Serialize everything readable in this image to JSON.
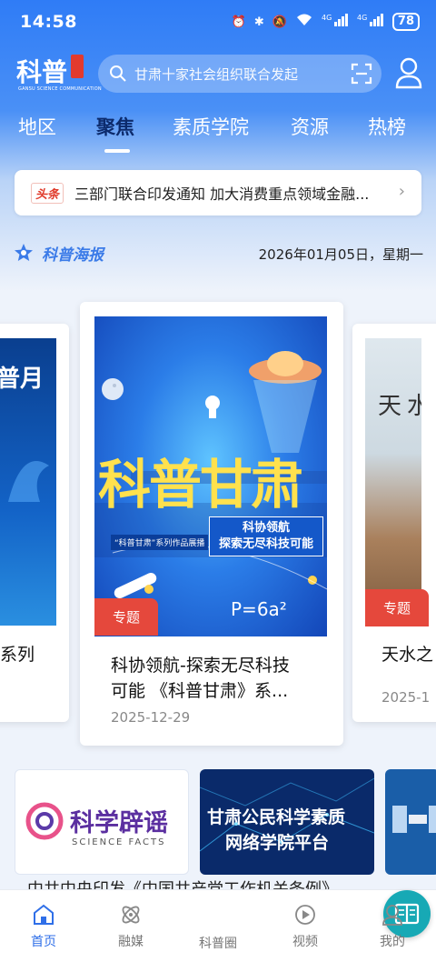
{
  "status_bar": {
    "time": "14:58",
    "network": "4G",
    "battery": "78"
  },
  "header": {
    "logo_text": "科普",
    "logo_subtext": "GANSU SCIENCE COMMUNICATION",
    "search_placeholder": "甘肃十家社会组织联合发起"
  },
  "tabs": [
    {
      "label": "地区",
      "active": false
    },
    {
      "label": "聚焦",
      "active": true
    },
    {
      "label": "素质学院",
      "active": false
    },
    {
      "label": "资源",
      "active": false
    },
    {
      "label": "热榜",
      "active": false
    }
  ],
  "headline": {
    "badge": "头条",
    "text": "三部门联合印发通知 加大消费重点领域金融..."
  },
  "section": {
    "title": "科普海报",
    "date": "2026年01月05日，星期一"
  },
  "cards": {
    "left": {
      "poster_text": "普月",
      "title": "系列"
    },
    "center": {
      "tag": "专题",
      "poster_title": "科普甘肃",
      "poster_subtitle": "“科普甘肃”系列作品展播",
      "poster_slogan_1": "科协领航",
      "poster_slogan_2": "探索无尽科技可能",
      "poster_formula": "P=6a²",
      "title_line1": "科协领航-探索无尽科技",
      "title_line2": "可能 《科普甘肃》系...",
      "date": "2025-12-29"
    },
    "right": {
      "tag": "专题",
      "poster_text": "天水",
      "title": "天水之",
      "date": "2025-1"
    }
  },
  "banners": [
    {
      "title": "科学辟谣",
      "subtitle": "SCIENCE FACTS"
    },
    {
      "title_line1": "甘肃公民科学素质",
      "title_line2": "网络学院平台"
    }
  ],
  "peek_text": "中共中央印发《中国共产党工作机关条例》",
  "bottom_nav": [
    {
      "label": "首页",
      "icon": "home-icon",
      "active": true
    },
    {
      "label": "融媒",
      "icon": "media-icon",
      "active": false
    },
    {
      "label": "科普圈",
      "icon": "book-icon",
      "active": false
    },
    {
      "label": "视频",
      "icon": "play-icon",
      "active": false
    },
    {
      "label": "我的",
      "icon": "profile-icon",
      "active": false
    }
  ],
  "colors": {
    "primary": "#2f7cf6",
    "active_tab_text": "#0c2a6b",
    "tag_red": "#e5483c",
    "center_nav": "#17a9b5",
    "nav_active": "#2f6fe8"
  }
}
